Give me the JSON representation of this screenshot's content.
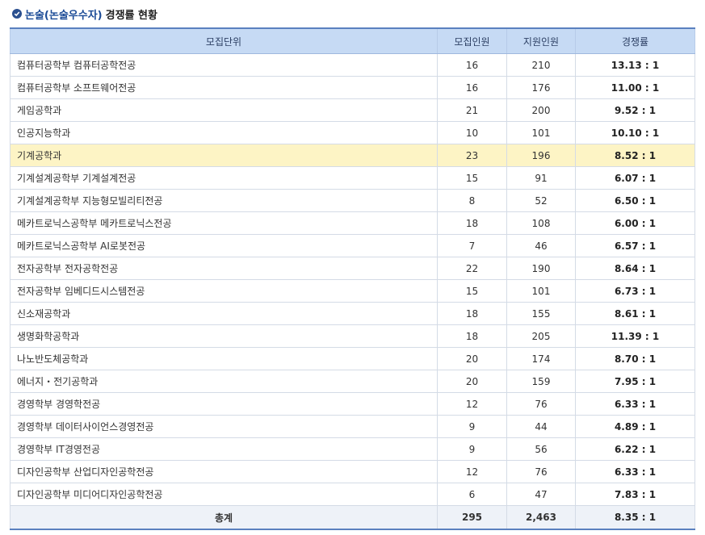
{
  "heading": {
    "prefix": "논술(논술우수자)",
    "suffix": "경쟁률 현황"
  },
  "table": {
    "headers": [
      "모집단위",
      "모집인원",
      "지원인원",
      "경쟁률"
    ],
    "rows": [
      {
        "name": "컴퓨터공학부 컴퓨터공학전공",
        "quota": "16",
        "applicants": "210",
        "ratio": "13.13 : 1"
      },
      {
        "name": "컴퓨터공학부 소프트웨어전공",
        "quota": "16",
        "applicants": "176",
        "ratio": "11.00 : 1"
      },
      {
        "name": "게임공학과",
        "quota": "21",
        "applicants": "200",
        "ratio": "9.52 : 1"
      },
      {
        "name": "인공지능학과",
        "quota": "10",
        "applicants": "101",
        "ratio": "10.10 : 1"
      },
      {
        "name": "기계공학과",
        "quota": "23",
        "applicants": "196",
        "ratio": "8.52 : 1"
      },
      {
        "name": "기계설계공학부 기계설계전공",
        "quota": "15",
        "applicants": "91",
        "ratio": "6.07 : 1"
      },
      {
        "name": "기계설계공학부 지능형모빌리티전공",
        "quota": "8",
        "applicants": "52",
        "ratio": "6.50 : 1"
      },
      {
        "name": "메카트로닉스공학부 메카트로닉스전공",
        "quota": "18",
        "applicants": "108",
        "ratio": "6.00 : 1"
      },
      {
        "name": "메카트로닉스공학부 AI로봇전공",
        "quota": "7",
        "applicants": "46",
        "ratio": "6.57 : 1"
      },
      {
        "name": "전자공학부 전자공학전공",
        "quota": "22",
        "applicants": "190",
        "ratio": "8.64 : 1"
      },
      {
        "name": "전자공학부 임베디드시스템전공",
        "quota": "15",
        "applicants": "101",
        "ratio": "6.73 : 1"
      },
      {
        "name": "신소재공학과",
        "quota": "18",
        "applicants": "155",
        "ratio": "8.61 : 1"
      },
      {
        "name": "생명화학공학과",
        "quota": "18",
        "applicants": "205",
        "ratio": "11.39 : 1"
      },
      {
        "name": "나노반도체공학과",
        "quota": "20",
        "applicants": "174",
        "ratio": "8.70 : 1"
      },
      {
        "name": "에너지・전기공학과",
        "quota": "20",
        "applicants": "159",
        "ratio": "7.95 : 1"
      },
      {
        "name": "경영학부 경영학전공",
        "quota": "12",
        "applicants": "76",
        "ratio": "6.33 : 1"
      },
      {
        "name": "경영학부 데이터사이언스경영전공",
        "quota": "9",
        "applicants": "44",
        "ratio": "4.89 : 1"
      },
      {
        "name": "경영학부 IT경영전공",
        "quota": "9",
        "applicants": "56",
        "ratio": "6.22 : 1"
      },
      {
        "name": "디자인공학부 산업디자인공학전공",
        "quota": "12",
        "applicants": "76",
        "ratio": "6.33 : 1"
      },
      {
        "name": "디자인공학부 미디어디자인공학전공",
        "quota": "6",
        "applicants": "47",
        "ratio": "7.83 : 1"
      }
    ],
    "total": {
      "name": "총계",
      "quota": "295",
      "applicants": "2,463",
      "ratio": "8.35 : 1"
    }
  },
  "colors": {
    "header_bg": "#c6daf4",
    "accent": "#5a80bf",
    "highlight_row": "#fdf4c5"
  }
}
